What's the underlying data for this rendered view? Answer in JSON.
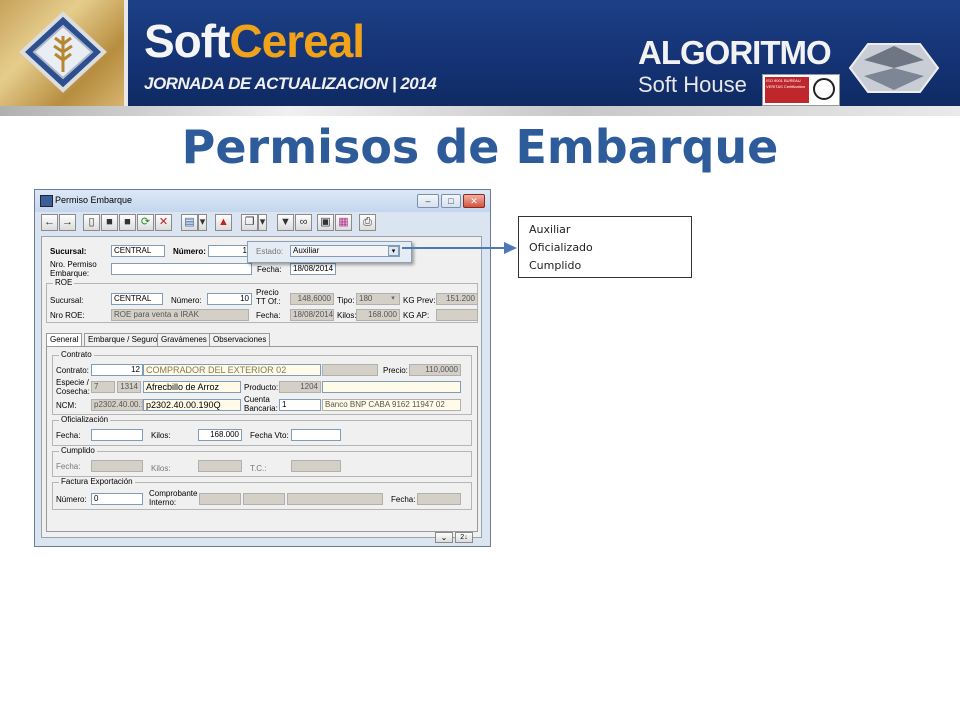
{
  "banner": {
    "soft": "Soft",
    "cereal": "Cereal",
    "event": "JORNADA DE ACTUALIZACION | 2014",
    "company_title": "ALGORITMO",
    "company_sub": "Soft House",
    "cert_text": "ISO 9001 BUREAU VERITAS Certification"
  },
  "page_title": "Permisos de Embarque",
  "window": {
    "title": "Permiso Embarque",
    "controls": [
      "–",
      "□",
      "✕"
    ]
  },
  "header_form": {
    "sucursal_label": "Sucursal:",
    "sucursal_value": "CENTRAL",
    "numero_label": "Número:",
    "numero_value": "1",
    "estado_label": "Estado:",
    "estado_value": "Auxiliar",
    "nro_permiso_label": "Nro. Permiso Embarque:",
    "nro_permiso_value": "",
    "fecha_label": "Fecha:",
    "fecha_value": "18/08/2014"
  },
  "roe": {
    "title": "ROE",
    "sucursal_label": "Sucursal:",
    "sucursal_value": "CENTRAL",
    "numero_label": "Número:",
    "numero_value": "10",
    "precio_label": "Precio TT Of.:",
    "precio_value": "148,6000",
    "tipo_label": "Tipo:",
    "tipo_value": "180",
    "kg_prev_label": "KG Prev:",
    "kg_prev_value": "151.200",
    "nro_roe_label": "Nro ROE:",
    "nro_roe_value": "ROE para venta a IRAK",
    "fecha_label": "Fecha:",
    "fecha_value": "18/08/2014",
    "kilos_label": "Kilos:",
    "kilos_value": "168.000",
    "kg_ap_label": "KG AP:",
    "kg_ap_value": ""
  },
  "tabs": [
    "General",
    "Embarque / Seguro",
    "Gravámenes",
    "Observaciones"
  ],
  "contrato": {
    "title": "Contrato",
    "contrato_label": "Contrato:",
    "contrato_value": "12",
    "contrato_name": "COMPRADOR DEL EXTERIOR 02",
    "precio_label": "Precio:",
    "precio_value": "110,0000",
    "especie_label": "Especie / Cosecha:",
    "especie_code": "7",
    "cosecha_code": "1314",
    "especie_name": "Afrecbillo de Arroz",
    "producto_label": "Producto:",
    "producto_value": "1204",
    "ncm_label": "NCM:",
    "ncm_code": "p2302.40.00.1",
    "ncm_value": "p2302.40.00.190Q",
    "cuenta_label": "Cuenta Bancaria:",
    "cuenta_value": "1",
    "banco_value": "Banco BNP CABA 9162 11947 02"
  },
  "oficializacion": {
    "title": "Oficialización",
    "fecha_label": "Fecha:",
    "kilos_label": "Kilos:",
    "kilos_value": "168.000",
    "fecha_vto_label": "Fecha Vto:"
  },
  "cumplido": {
    "title": "Cumplido",
    "fecha_label": "Fecha:",
    "kilos_label": "Kilos:",
    "tc_label": "T.C.:"
  },
  "factura": {
    "title": "Factura Exportación",
    "numero_label": "Número:",
    "numero_value": "0",
    "comprobante_label": "Comprobante Interno:",
    "fecha_label": "Fecha:"
  },
  "callout": {
    "options": [
      "Auxiliar",
      "Oficializado",
      "Cumplido"
    ]
  },
  "colors": {
    "title_blue": "#2e5b9a",
    "banner_blue": "#143273",
    "cereal_orange": "#f0a21b"
  }
}
